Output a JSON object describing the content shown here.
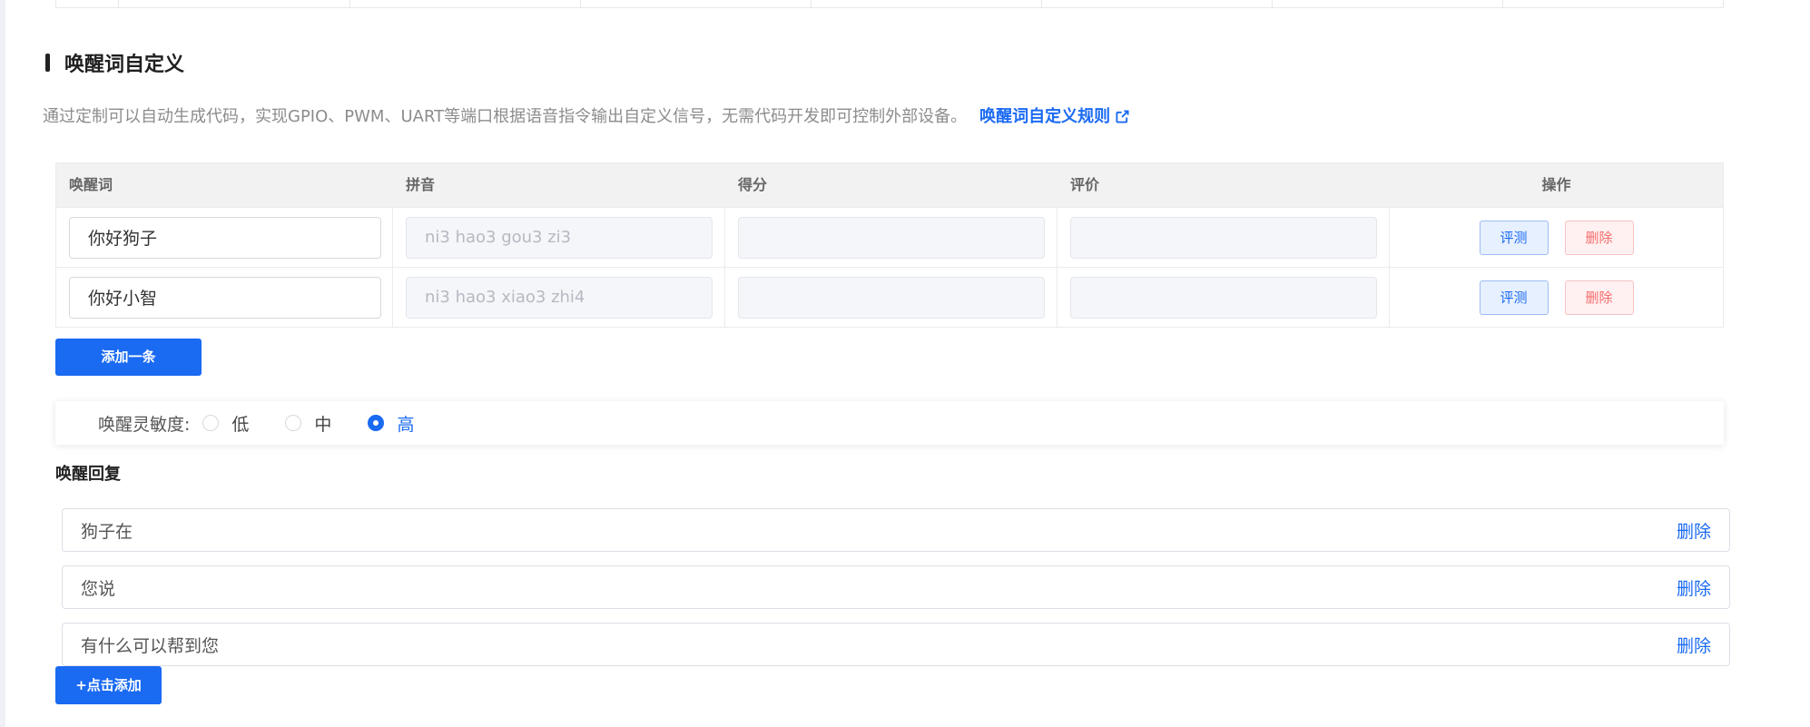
{
  "section": {
    "title": "唤醒词自定义",
    "description": "通过定制可以自动生成代码，实现GPIO、PWM、UART等端口根据语音指令输出自定义信号，无需代码开发即可控制外部设备。",
    "rule_link": "唤醒词自定义规则"
  },
  "table": {
    "headers": {
      "word": "唤醒词",
      "pinyin": "拼音",
      "score": "得分",
      "review": "评价",
      "actions": "操作"
    },
    "rows": [
      {
        "word": "你好狗子",
        "pinyin": "ni3 hao3 gou3 zi3",
        "score": "",
        "review": "",
        "eval_label": "评测",
        "delete_label": "删除"
      },
      {
        "word": "你好小智",
        "pinyin": "ni3 hao3 xiao3 zhi4",
        "score": "",
        "review": "",
        "eval_label": "评测",
        "delete_label": "删除"
      }
    ],
    "add_label": "添加一条"
  },
  "sensitivity": {
    "label": "唤醒灵敏度:",
    "options": [
      "低",
      "中",
      "高"
    ],
    "selected": "高"
  },
  "reply": {
    "title": "唤醒回复",
    "items": [
      {
        "text": "狗子在",
        "delete_label": "删除"
      },
      {
        "text": "您说",
        "delete_label": "删除"
      },
      {
        "text": "有什么可以帮到您",
        "delete_label": "删除"
      }
    ],
    "add_label": "+点击添加"
  },
  "colors": {
    "primary": "#1a6af2",
    "danger": "#f56c6c",
    "header_bg": "#f2f2f2"
  }
}
